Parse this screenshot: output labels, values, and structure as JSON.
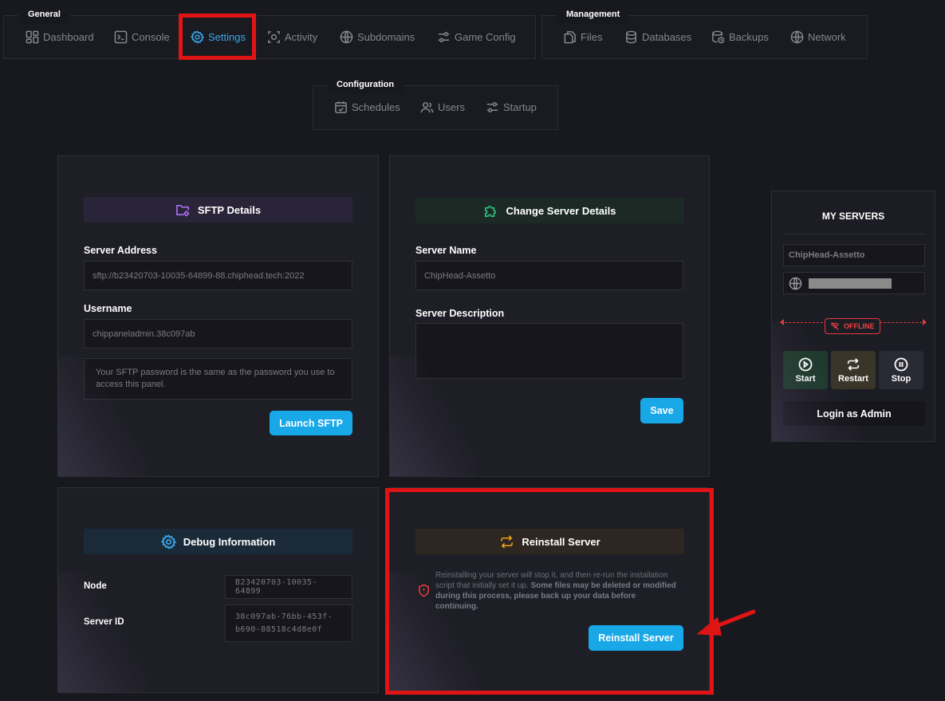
{
  "nav": {
    "general": {
      "legend": "General",
      "items": [
        {
          "label": "Dashboard",
          "icon": "dashboard-icon"
        },
        {
          "label": "Console",
          "icon": "console-icon"
        },
        {
          "label": "Settings",
          "icon": "gear-icon",
          "active": true
        },
        {
          "label": "Activity",
          "icon": "activity-icon"
        },
        {
          "label": "Subdomains",
          "icon": "globe-icon"
        },
        {
          "label": "Game Config",
          "icon": "sliders-icon"
        }
      ]
    },
    "management": {
      "legend": "Management",
      "items": [
        {
          "label": "Files",
          "icon": "files-icon"
        },
        {
          "label": "Databases",
          "icon": "database-icon"
        },
        {
          "label": "Backups",
          "icon": "backup-icon"
        },
        {
          "label": "Network",
          "icon": "globe-icon"
        }
      ]
    },
    "configuration": {
      "legend": "Configuration",
      "items": [
        {
          "label": "Schedules",
          "icon": "calendar-icon"
        },
        {
          "label": "Users",
          "icon": "users-icon"
        },
        {
          "label": "Startup",
          "icon": "sliders-icon"
        }
      ]
    }
  },
  "sftp": {
    "title": "SFTP Details",
    "server_address_label": "Server Address",
    "server_address": "sftp://b23420703-10035-64899-88.chiphead.tech:2022",
    "username_label": "Username",
    "username": "chippaneladmin.38c097ab",
    "note": "Your SFTP password is the same as the password you use to access this panel.",
    "launch_button": "Launch SFTP"
  },
  "details": {
    "title": "Change Server Details",
    "name_label": "Server Name",
    "name_placeholder": "ChipHead-Assetto",
    "description_label": "Server Description",
    "description_value": "",
    "save_button": "Save"
  },
  "debug": {
    "title": "Debug Information",
    "node_label": "Node",
    "node_value": "B23420703-10035-64899",
    "server_id_label": "Server ID",
    "server_id_value": "38c097ab-76bb-453f-b690-88518c4d8e0f"
  },
  "reinstall": {
    "title": "Reinstall Server",
    "text_plain": "Reinstalling your server will stop it, and then re-run the installation script that initially set it up.",
    "text_bold": "Some files may be deleted or modified during this process, please back up your data before continuing.",
    "button": "Reinstall Server"
  },
  "my_servers": {
    "title": "MY SERVERS",
    "server_name": "ChipHead-Assetto",
    "status": "OFFLINE",
    "start": "Start",
    "restart": "Restart",
    "stop": "Stop",
    "login_admin": "Login as Admin"
  },
  "colors": {
    "accent": "#18a8e8",
    "highlight": "#e01414",
    "offline": "#ef4444"
  }
}
